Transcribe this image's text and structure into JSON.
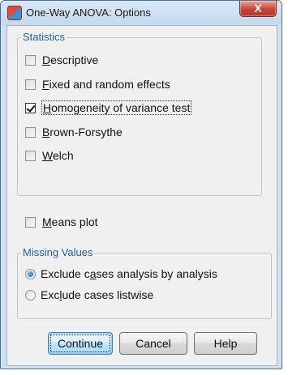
{
  "window": {
    "title": "One-Way ANOVA: Options",
    "close_glyph": "X",
    "app_icon": "spss-app-icon"
  },
  "statistics": {
    "group_label": "Statistics",
    "items": [
      {
        "label_pre": "",
        "mnemonic": "D",
        "label_post": "escriptive",
        "checked": false
      },
      {
        "label_pre": "",
        "mnemonic": "F",
        "label_post": "ixed and random effects",
        "checked": false
      },
      {
        "label_pre": "",
        "mnemonic": "H",
        "label_post": "omogeneity of variance test",
        "checked": true
      },
      {
        "label_pre": "",
        "mnemonic": "B",
        "label_post": "rown-Forsythe",
        "checked": false
      },
      {
        "label_pre": "",
        "mnemonic": "W",
        "label_post": "elch",
        "checked": false
      }
    ]
  },
  "means_plot": {
    "label_pre": "",
    "mnemonic": "M",
    "label_post": "eans plot",
    "checked": false
  },
  "missing_values": {
    "group_label": "Missing Values",
    "options": [
      {
        "label_pre": "Exclude c",
        "mnemonic": "a",
        "label_post": "ses analysis by analysis",
        "selected": true
      },
      {
        "label_pre": "Exc",
        "mnemonic": "l",
        "label_post": "ude cases listwise",
        "selected": false
      }
    ]
  },
  "buttons": {
    "continue_label": "Continue",
    "cancel_label": "Cancel",
    "help_label": "Help"
  }
}
